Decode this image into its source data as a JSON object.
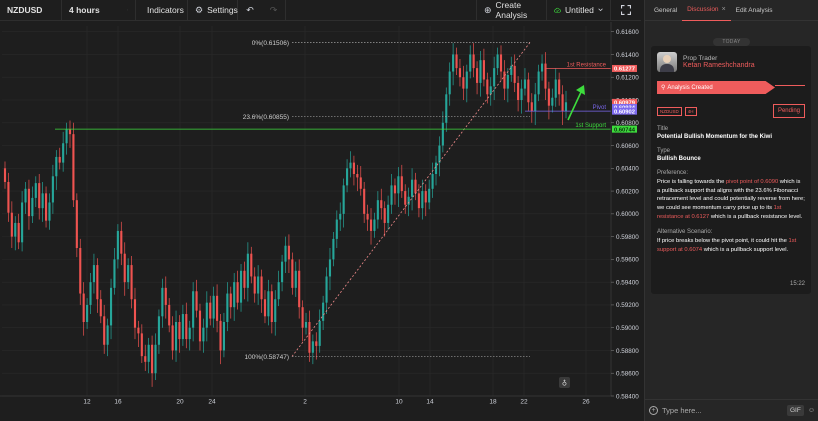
{
  "toolbar": {
    "symbol": "NZDUSD",
    "interval": "4 hours",
    "indicators": "Indicators",
    "settings": "Settings",
    "create_analysis": "Create Analysis",
    "layout_name": "Untitled"
  },
  "chart_data": {
    "type": "candlestick",
    "symbol": "NZDUSD",
    "y_ticks": [
      "0.61600",
      "0.61400",
      "0.61200",
      "0.61000",
      "0.60800",
      "0.60600",
      "0.60400",
      "0.60200",
      "0.60000",
      "0.59800",
      "0.59600",
      "0.59400",
      "0.59200",
      "0.59000",
      "0.58800",
      "0.58600",
      "0.58400"
    ],
    "ylim": [
      0.584,
      0.6165
    ],
    "x_ticks": [
      "12",
      "16",
      "20",
      "24",
      "2",
      "10",
      "14",
      "18",
      "22",
      "26"
    ],
    "series_close": [
      0.6028,
      0.6001,
      0.598,
      0.5992,
      0.5975,
      0.601,
      0.6022,
      0.5998,
      0.6014,
      0.6027,
      0.6005,
      0.6018,
      0.5994,
      0.601,
      0.6033,
      0.605,
      0.6045,
      0.6062,
      0.6074,
      0.607,
      0.6012,
      0.597,
      0.593,
      0.5905,
      0.592,
      0.594,
      0.5955,
      0.5925,
      0.591,
      0.5885,
      0.5902,
      0.5935,
      0.596,
      0.5985,
      0.5965,
      0.594,
      0.5955,
      0.5925,
      0.59,
      0.5895,
      0.5875,
      0.587,
      0.5885,
      0.586,
      0.5885,
      0.591,
      0.5935,
      0.592,
      0.5902,
      0.588,
      0.5905,
      0.589,
      0.5912,
      0.589,
      0.59,
      0.5932,
      0.5915,
      0.5888,
      0.59,
      0.5922,
      0.5908,
      0.5928,
      0.5906,
      0.588,
      0.5905,
      0.593,
      0.5918,
      0.594,
      0.5922,
      0.595,
      0.5935,
      0.5965,
      0.5945,
      0.593,
      0.5945,
      0.5925,
      0.591,
      0.5932,
      0.5905,
      0.5925,
      0.594,
      0.5958,
      0.5972,
      0.596,
      0.5935,
      0.595,
      0.5918,
      0.59,
      0.5905,
      0.5878,
      0.5888,
      0.5884,
      0.5906,
      0.5922,
      0.5945,
      0.596,
      0.5978,
      0.5995,
      0.6,
      0.6025,
      0.604,
      0.6045,
      0.6035,
      0.6032,
      0.6022,
      0.6,
      0.5995,
      0.5985,
      0.5995,
      0.6012,
      0.6005,
      0.5992,
      0.6008,
      0.6025,
      0.6018,
      0.6033,
      0.602,
      0.6008,
      0.6015,
      0.603,
      0.6018,
      0.6005,
      0.602,
      0.601,
      0.6022,
      0.6035,
      0.6045,
      0.606,
      0.608,
      0.6105,
      0.6125,
      0.614,
      0.6128,
      0.612,
      0.611,
      0.6125,
      0.614,
      0.6128,
      0.6115,
      0.6135,
      0.6118,
      0.6105,
      0.6112,
      0.6128,
      0.614,
      0.6125,
      0.611,
      0.6122,
      0.613,
      0.6115,
      0.61,
      0.611,
      0.6118,
      0.6098,
      0.609,
      0.6105,
      0.6125,
      0.6132,
      0.611,
      0.6095,
      0.6102,
      0.6118,
      0.6105,
      0.609,
      0.6098
    ],
    "series_first_open": 0.604,
    "fibonacci": [
      {
        "label": "0%(0.61506)",
        "value": 0.61506
      },
      {
        "label": "23.6%(0.60855)",
        "value": 0.60855
      },
      {
        "label": "100%(0.58747)",
        "value": 0.58747
      }
    ],
    "levels": [
      {
        "label": "1st Resistance",
        "value": 0.61277,
        "tag": "0.61277",
        "color": "#ef5c5c"
      },
      {
        "label": "Pivot",
        "value": 0.60902,
        "tag": "0.60902",
        "color": "#7b68ee"
      },
      {
        "label": "1st Support",
        "value": 0.60744,
        "tag": "0.60744",
        "color": "#3ddc3d"
      }
    ],
    "price_tags_hidden": [
      "0.60979",
      "0.60934"
    ]
  },
  "panel": {
    "tabs": [
      "General",
      "Discussion",
      "Edit Analysis"
    ],
    "today": "TODAY",
    "author_role": "Prop Trader",
    "author_name": "Ketan Rameshchandra",
    "created": "Analysis Created",
    "tag_symbol": "NZDUSD",
    "tag_interval": "4H",
    "status": "Pending",
    "title_label": "Title",
    "title_value": "Potential Bullish Momentum for the Kiwi",
    "type_label": "Type",
    "type_value": "Bullish Bounce",
    "pref_label": "Preference:",
    "pref_text": {
      "t1": "Price is falling towards the ",
      "h1": "pivot point of 0.6090",
      "t2": " which is a pullback support that aligns with the 23.6% Fibonacci retracement level and could potentially reverse from here; we could see momentum carry price up to its ",
      "h2": "1st resistance at 0.6127",
      "t3": " which is a pullback resistance level."
    },
    "alt_label": "Alternative Scenario:",
    "alt_text": {
      "t1": "If price breaks below the pivot point, it could hit the ",
      "h1": "1st support at 0.6074",
      "t2": " which is a pullback support level."
    },
    "time": "15:22",
    "input_placeholder": "Type here...",
    "gif": "GIF"
  }
}
